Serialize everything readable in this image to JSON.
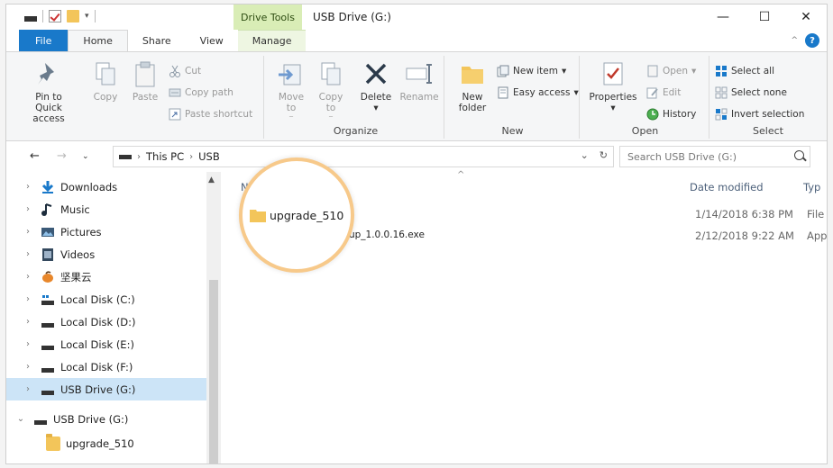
{
  "titlebar": {
    "context_tab": "Drive Tools",
    "title": "USB Drive (G:)",
    "minimize": "—",
    "maximize": "☐",
    "close": "✕"
  },
  "tabs": [
    "File",
    "Home",
    "Share",
    "View",
    "Manage"
  ],
  "ribbon": {
    "clipboard": {
      "pin": "Pin to Quick access",
      "copy": "Copy",
      "paste": "Paste",
      "cut": "Cut",
      "copy_path": "Copy path",
      "paste_shortcut": "Paste shortcut"
    },
    "organize": {
      "label": "Organize",
      "move_to": "Move to",
      "copy_to": "Copy to",
      "delete": "Delete",
      "rename": "Rename"
    },
    "new": {
      "label": "New",
      "new_folder": "New folder",
      "new_item": "New item",
      "easy_access": "Easy access"
    },
    "open": {
      "label": "Open",
      "properties": "Properties",
      "open": "Open",
      "edit": "Edit",
      "history": "History"
    },
    "select": {
      "label": "Select",
      "select_all": "Select all",
      "select_none": "Select none",
      "invert": "Invert selection"
    }
  },
  "address": {
    "crumbs": [
      "This PC",
      "USB"
    ],
    "search_placeholder": "Search USB Drive (G:)"
  },
  "nav": {
    "items": [
      {
        "label": "Downloads",
        "icon": "download-icon"
      },
      {
        "label": "Music",
        "icon": "music-icon"
      },
      {
        "label": "Pictures",
        "icon": "pictures-icon"
      },
      {
        "label": "Videos",
        "icon": "videos-icon"
      },
      {
        "label": "坚果云",
        "icon": "nutstore-icon"
      },
      {
        "label": "Local Disk (C:)",
        "icon": "system-disk-icon"
      },
      {
        "label": "Local Disk (D:)",
        "icon": "disk-icon"
      },
      {
        "label": "Local Disk (E:)",
        "icon": "disk-icon"
      },
      {
        "label": "Local Disk (F:)",
        "icon": "disk-icon"
      },
      {
        "label": "USB Drive (G:)",
        "icon": "usb-drive-icon"
      },
      {
        "label": "USB Drive (G:)",
        "icon": "usb-drive-icon"
      },
      {
        "label": "upgrade_510",
        "icon": "folder-icon"
      }
    ]
  },
  "files": {
    "columns": [
      "Name",
      "Date modified",
      "Typ"
    ],
    "rows": [
      {
        "name": "upgrade_510",
        "date": "1/14/2018 6:38 PM",
        "type": "File"
      },
      {
        "name": "MaxHubFamilySetup_1.0.0.16.exe",
        "date": "2/12/2018 9:22 AM",
        "type": "App"
      }
    ]
  },
  "highlight": {
    "label": "upgrade_510"
  }
}
